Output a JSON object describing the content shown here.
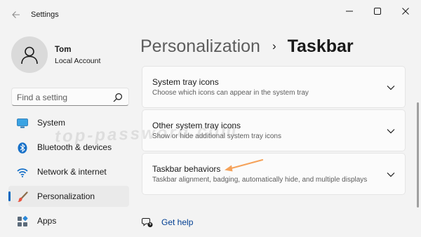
{
  "window": {
    "title": "Settings",
    "controls": {
      "minimize": "minimize-icon",
      "maximize": "maximize-icon",
      "close": "close-icon"
    }
  },
  "user": {
    "name": "Tom",
    "account_type": "Local Account"
  },
  "search": {
    "placeholder": "Find a setting"
  },
  "sidebar": {
    "items": [
      {
        "label": "System",
        "icon": "system-icon"
      },
      {
        "label": "Bluetooth & devices",
        "icon": "bluetooth-icon"
      },
      {
        "label": "Network & internet",
        "icon": "wifi-icon"
      },
      {
        "label": "Personalization",
        "icon": "brush-icon",
        "active": true
      },
      {
        "label": "Apps",
        "icon": "apps-icon"
      }
    ]
  },
  "breadcrumb": {
    "parent": "Personalization",
    "separator": "›",
    "current": "Taskbar"
  },
  "cards": [
    {
      "title": "System tray icons",
      "description": "Choose which icons can appear in the system tray"
    },
    {
      "title": "Other system tray icons",
      "description": "Show or hide additional system tray icons"
    },
    {
      "title": "Taskbar behaviors",
      "description": "Taskbar alignment, badging, automatically hide, and multiple displays"
    }
  ],
  "help": {
    "label": "Get help"
  },
  "watermark": "top-password.com",
  "colors": {
    "accent": "#0067c0",
    "annotation_arrow": "#f5a25a",
    "link": "#003e92"
  }
}
